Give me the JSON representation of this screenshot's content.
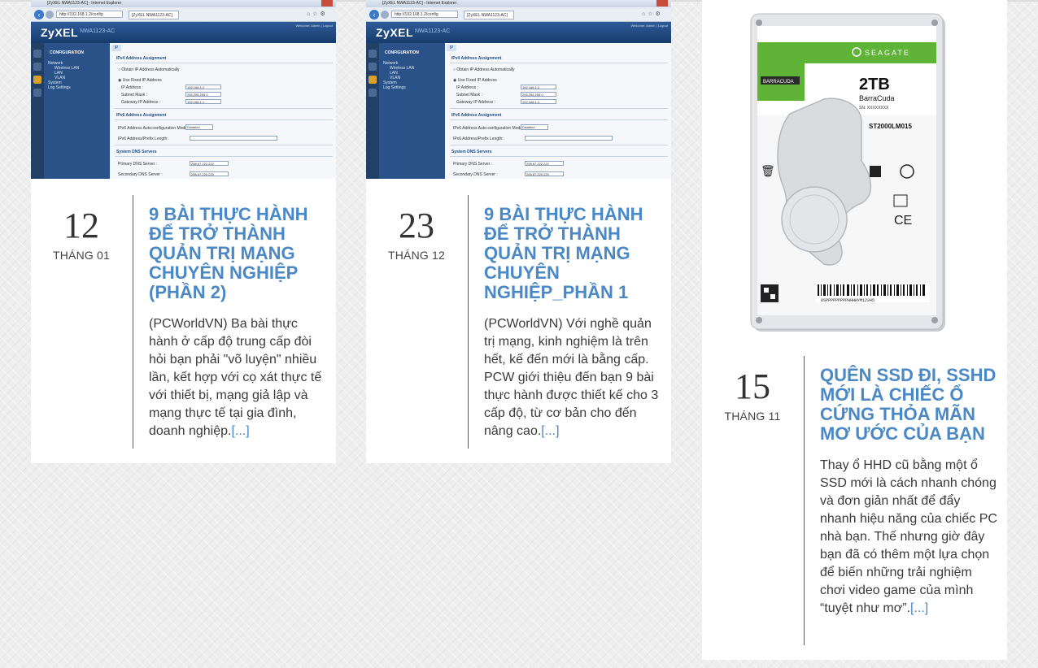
{
  "screenshot_ui": {
    "ie_title": "[ZyXEL NWA1123-AC] - Internet Explorer",
    "url": "http://192.168.1.2/config",
    "tab_label": "[ZyXEL NWA1123-AC]",
    "logo": "ZyXEL",
    "model": "NWA1123-AC",
    "welcome": "Welcome: Admin | Logout",
    "configuration": "CONFIGURATION",
    "menu": [
      "Network",
      "Wireless LAN",
      "LAN",
      "VLAN",
      "System",
      "Log Settings"
    ],
    "tab_ip": "IP",
    "ipv4_section": "IPv4 Address Assignment",
    "obtain_auto": "Obtain IP Address Automatically",
    "use_fixed": "Use Fixed IP Address",
    "ip_label": "IP Address :",
    "ip_value": "192.168.1.2",
    "mask_label": "Subnet Mask :",
    "mask_value": "255.255.255.0",
    "gw_label": "Gateway IP Address :",
    "gw_value": "192.168.1.1",
    "ipv6_section": "IPv6 Address Assignment",
    "ipv6_mode_label": "IPv6 Address Auto-configuration Mode:",
    "ipv6_mode_value": "Disabled",
    "ipv6_prefix_label": "IPv6 Address/Prefix Length:",
    "dns_section": "System DNS Servers",
    "dns1_label": "Primary DNS Server :",
    "dns1_value": "208.67.222.222",
    "dns2_label": "Secondary DNS Server :",
    "dns2_value": "208.67.220.220"
  },
  "hdd": {
    "brand": "SEAGATE",
    "badge": "BARRACUDA",
    "capacity": "2TB",
    "series": "BarraCuda",
    "sn": "SN: XXXXXXXX",
    "model": "ST2000LM015",
    "barcode_text": "8SPPPPPPPPPHHHHYM12345"
  },
  "posts": [
    {
      "day": "12",
      "month": "THÁNG 01",
      "title": "9 BÀI THỰC HÀNH ĐỂ TRỞ THÀNH QUẢN TRỊ MẠNG CHUYÊN NGHIỆP (PHẦN 2)",
      "excerpt": "(PCWorldVN) Ba bài thực hành ở cấp độ trung cấp đòi hỏi bạn phải \"võ luyện\" nhiều lần, kết hợp với cọ xát thực tế với thiết bị, mạng giả lập và mạng thực tế tại gia đình, doanh nghiệp.",
      "more": "[...]"
    },
    {
      "day": "23",
      "month": "THÁNG 12",
      "title": "9 BÀI THỰC HÀNH ĐỂ TRỞ THÀNH QUẢN TRỊ MẠNG CHUYÊN NGHIỆP_PHẦN 1",
      "excerpt": "(PCWorldVN) Với nghề quản trị mạng, kinh nghiệm là trên hết, kế đến mới là bằng cấp. PCW giới thiệu đến bạn 9 bài thực hành được thiết kế cho 3 cấp độ, từ cơ bản cho đến nâng cao.",
      "more": "[...]"
    },
    {
      "day": "15",
      "month": "THÁNG 11",
      "title": "QUÊN SSD ĐI, SSHD MỚI LÀ CHIẾC Ổ CỨNG THỎA MÃN MƠ ƯỚC CỦA BẠN",
      "excerpt": "Thay ổ HHD cũ bằng một ổ SSD mới là cách nhanh chóng và đơn giản nhất để đẩy nhanh hiệu năng của chiếc PC nhà bạn. Thế nhưng giờ đây bạn đã có thêm một lựa chọn để biến những trải nghiệm chơi video game của mình “tuyệt như mơ”.",
      "more": "[...]"
    }
  ]
}
